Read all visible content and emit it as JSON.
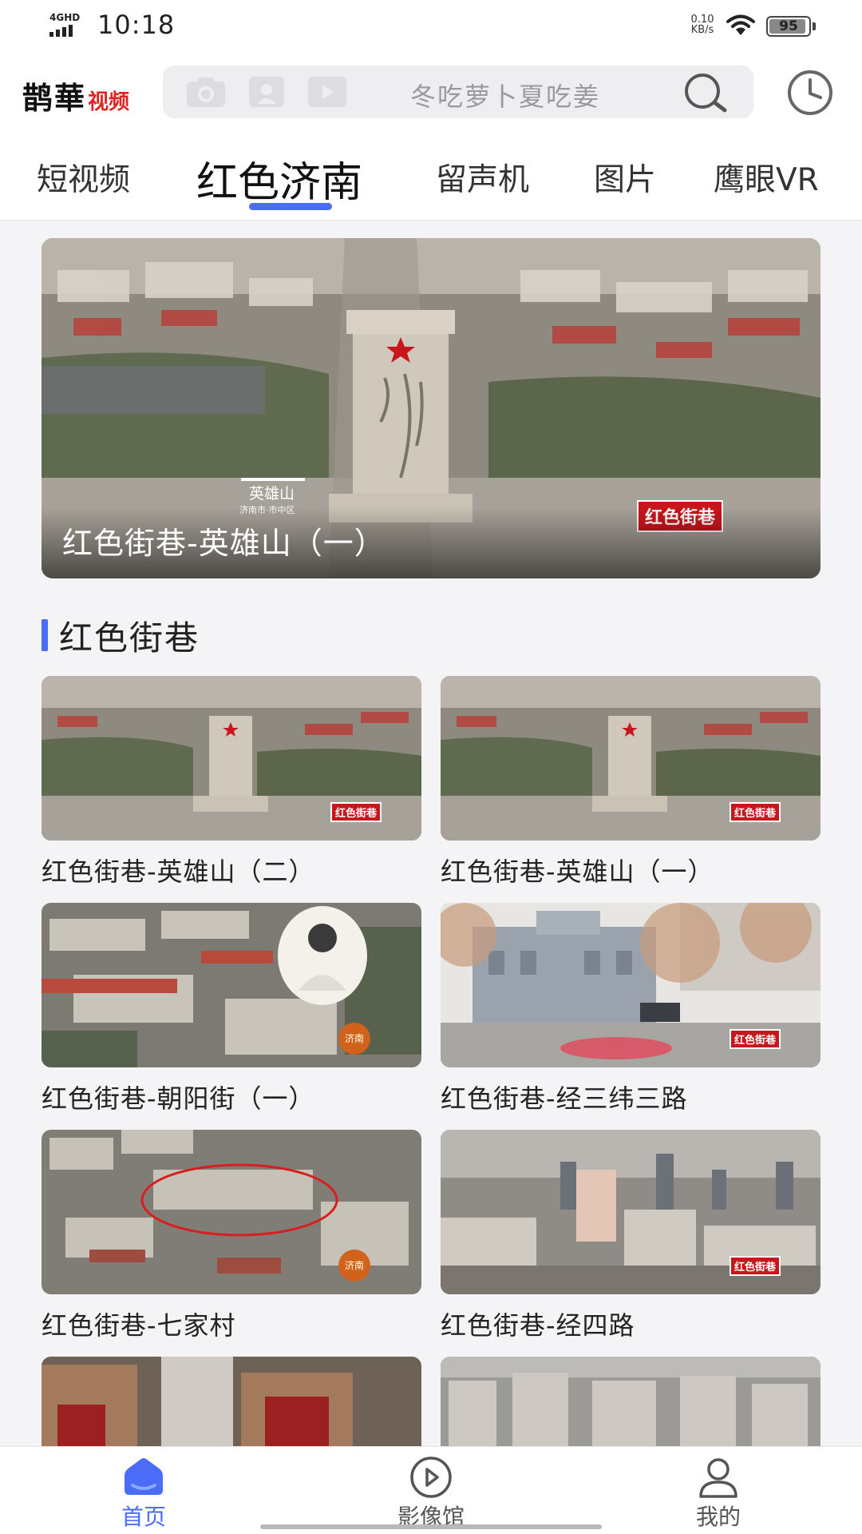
{
  "status_bar": {
    "network": "4GHD",
    "time": "10:18",
    "net_speed_value": "0.10",
    "net_speed_unit": "KB/s",
    "battery_level": "95",
    "battery_fraction": 0.95
  },
  "header": {
    "logo_main": "鹊華",
    "logo_sub": "视频",
    "search_placeholder": "冬吃萝卜夏吃姜",
    "search_icons": [
      "camera-icon",
      "scan-icon",
      "play-icon",
      "search-icon"
    ],
    "history_icon": "clock-icon"
  },
  "tabs": [
    {
      "label": "短视频",
      "active": false
    },
    {
      "label": "红色济南",
      "active": true
    },
    {
      "label": "留声机",
      "active": false
    },
    {
      "label": "图片",
      "active": false
    },
    {
      "label": "鹰眼VR",
      "active": false
    }
  ],
  "hero": {
    "title": "红色街巷-英雄山（一）",
    "badge": "红色街巷",
    "overlay_place": "英雄山",
    "overlay_district": "济南市·市中区"
  },
  "section": {
    "title": "红色街巷"
  },
  "videos": [
    {
      "title": "红色街巷-英雄山（二）",
      "badge": "红色街巷"
    },
    {
      "title": "红色街巷-英雄山（一）",
      "badge": "红色街巷"
    },
    {
      "title": "红色街巷-朝阳街（一）",
      "badge": "济南"
    },
    {
      "title": "红色街巷-经三纬三路",
      "badge": "红色街巷"
    },
    {
      "title": "红色街巷-七家村",
      "badge": "济南"
    },
    {
      "title": "红色街巷-经四路",
      "badge": "红色街巷"
    }
  ],
  "bottom_nav": [
    {
      "label": "首页",
      "icon": "home-icon",
      "active": true
    },
    {
      "label": "影像馆",
      "icon": "play-circle-icon",
      "active": false
    },
    {
      "label": "我的",
      "icon": "user-icon",
      "active": false
    }
  ],
  "colors": {
    "accent": "#4a6cf7",
    "badge_red": "#c8161d",
    "logo_red": "#e02424"
  }
}
